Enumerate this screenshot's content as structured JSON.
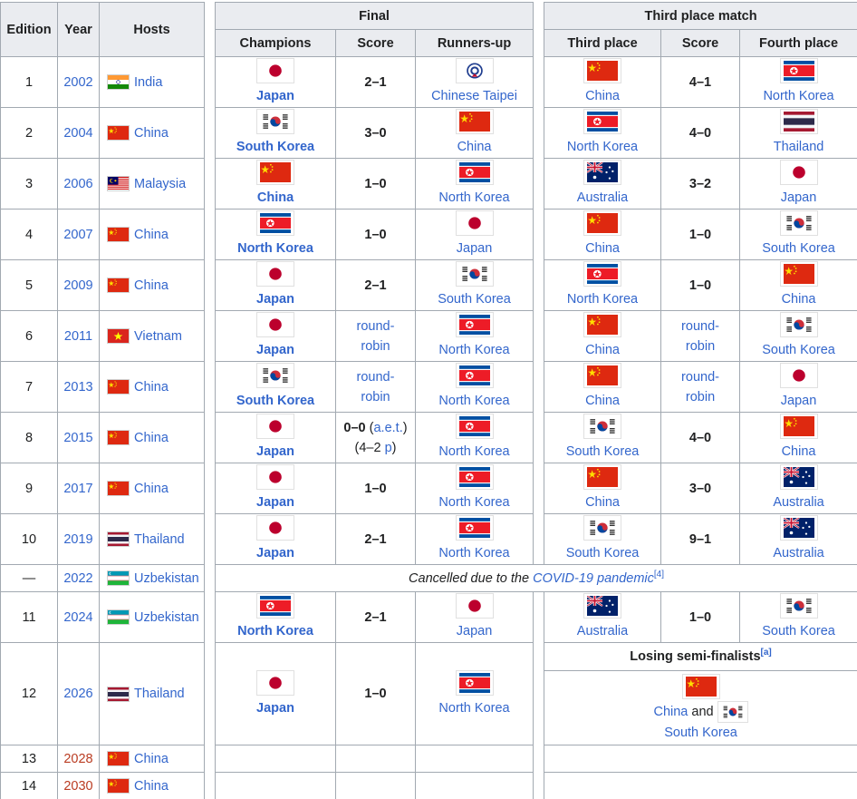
{
  "headers": {
    "edition": "Edition",
    "year": "Year",
    "hosts": "Hosts",
    "final": "Final",
    "third_place_match": "Third place match",
    "champions": "Champions",
    "score": "Score",
    "runners_up": "Runners-up",
    "third_place": "Third place",
    "score2": "Score",
    "fourth_place": "Fourth place"
  },
  "rows": [
    {
      "edition": "1",
      "year": "2002",
      "host": "India",
      "champion": "Japan",
      "score": "2–1",
      "runner": "Chinese Taipei",
      "third": "China",
      "score2": "4–1",
      "fourth": "North Korea"
    },
    {
      "edition": "2",
      "year": "2004",
      "host": "China",
      "champion": "South Korea",
      "score": "3–0",
      "runner": "China",
      "third": "North Korea",
      "score2": "4–0",
      "fourth": "Thailand"
    },
    {
      "edition": "3",
      "year": "2006",
      "host": "Malaysia",
      "champion": "China",
      "score": "1–0",
      "runner": "North Korea",
      "third": "Australia",
      "score2": "3–2",
      "fourth": "Japan"
    },
    {
      "edition": "4",
      "year": "2007",
      "host": "China",
      "champion": "North Korea",
      "score": "1–0",
      "runner": "Japan",
      "third": "China",
      "score2": "1–0",
      "fourth": "South Korea"
    },
    {
      "edition": "5",
      "year": "2009",
      "host": "China",
      "champion": "Japan",
      "score": "2–1",
      "runner": "South Korea",
      "third": "North Korea",
      "score2": "1–0",
      "fourth": "China"
    },
    {
      "edition": "6",
      "year": "2011",
      "host": "Vietnam",
      "champion": "Japan",
      "score_a": "round-",
      "score_b": "robin",
      "runner": "North Korea",
      "third": "China",
      "score2_a": "round-",
      "score2_b": "robin",
      "fourth": "South Korea"
    },
    {
      "edition": "7",
      "year": "2013",
      "host": "China",
      "champion": "South Korea",
      "score_a": "round-",
      "score_b": "robin",
      "runner": "North Korea",
      "third": "China",
      "score2_a": "round-",
      "score2_b": "robin",
      "fourth": "Japan"
    },
    {
      "edition": "8",
      "year": "2015",
      "host": "China",
      "champion": "Japan",
      "score_main": "0–0",
      "score_aet": "a.e.t.",
      "score_pens": "4–2",
      "score_p": "p",
      "runner": "North Korea",
      "third": "South Korea",
      "score2": "4–0",
      "fourth": "China"
    },
    {
      "edition": "9",
      "year": "2017",
      "host": "China",
      "champion": "Japan",
      "score": "1–0",
      "runner": "North Korea",
      "third": "China",
      "score2": "3–0",
      "fourth": "Australia"
    },
    {
      "edition": "10",
      "year": "2019",
      "host": "Thailand",
      "champion": "Japan",
      "score": "2–1",
      "runner": "North Korea",
      "third": "South Korea",
      "score2": "9–1",
      "fourth": "Australia"
    },
    {
      "edition": "—",
      "year": "2022",
      "host": "Uzbekistan",
      "cancel_text": "Cancelled due to the ",
      "cancel_link": "COVID-19 pandemic",
      "cancel_ref": "[4]"
    },
    {
      "edition": "11",
      "year": "2024",
      "host": "Uzbekistan",
      "champion": "North Korea",
      "score": "2–1",
      "runner": "Japan",
      "third": "Australia",
      "score2": "1–0",
      "fourth": "South Korea"
    },
    {
      "edition": "12",
      "year": "2026",
      "host": "Thailand",
      "champion": "Japan",
      "score": "1–0",
      "runner": "North Korea",
      "semi_header": "Losing semi-finalists",
      "semi_ref": "[a]",
      "semi_a": "China",
      "semi_and": "and",
      "semi_b": "South Korea"
    },
    {
      "edition": "13",
      "year": "2028",
      "host": "China"
    },
    {
      "edition": "14",
      "year": "2030",
      "host": "China"
    }
  ]
}
